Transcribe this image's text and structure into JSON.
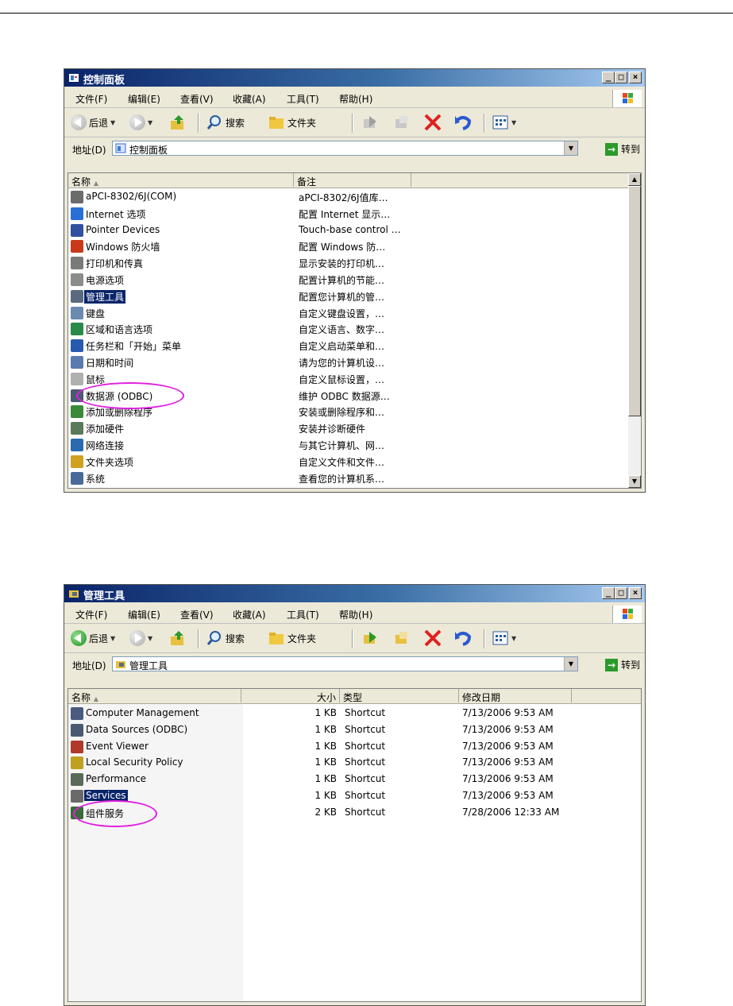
{
  "window1": {
    "title": "控制面板",
    "menu": [
      "文件(F)",
      "编辑(E)",
      "查看(V)",
      "收藏(A)",
      "工具(T)",
      "帮助(H)"
    ],
    "toolbar": {
      "back": "后退",
      "search": "搜索",
      "folders": "文件夹"
    },
    "address_label": "地址(D)",
    "address_value": "控制面板",
    "go_label": "转到",
    "columns": [
      "名称",
      "备注"
    ],
    "rows": [
      {
        "name": "aPCI-8302/6J(COM)",
        "note": "aPCI-8302/6J值库…",
        "icon_color": "#6b6b6b"
      },
      {
        "name": "Internet 选项",
        "note": "配置 Internet 显示…",
        "icon_color": "#2a6fd6"
      },
      {
        "name": "Pointer Devices",
        "note": "Touch-base control …",
        "icon_color": "#3050a0"
      },
      {
        "name": "Windows 防火墙",
        "note": "配置 Windows 防…",
        "icon_color": "#c83a1a"
      },
      {
        "name": "打印机和传真",
        "note": "显示安装的打印机…",
        "icon_color": "#7a7a7a"
      },
      {
        "name": "电源选项",
        "note": "配置计算机的节能…",
        "icon_color": "#8c8c8c"
      },
      {
        "name": "管理工具",
        "note": "配置您计算机的管…",
        "icon_color": "#5a6a80",
        "selected": true
      },
      {
        "name": "键盘",
        "note": "自定义键盘设置，…",
        "icon_color": "#6a8ab0"
      },
      {
        "name": "区域和语言选项",
        "note": "自定义语言、数字…",
        "icon_color": "#2a8a4a"
      },
      {
        "name": "任务栏和「开始」菜单",
        "note": "自定义启动菜单和…",
        "icon_color": "#2a5ab0"
      },
      {
        "name": "日期和时间",
        "note": "请为您的计算机设…",
        "icon_color": "#5a7ab0"
      },
      {
        "name": "鼠标",
        "note": "自定义鼠标设置，…",
        "icon_color": "#b0b0b0"
      },
      {
        "name": "数据源 (ODBC)",
        "note": "维护 ODBC 数据源…",
        "icon_color": "#4a5a70"
      },
      {
        "name": "添加或删除程序",
        "note": "安装或删除程序和…",
        "icon_color": "#3a8a3a"
      },
      {
        "name": "添加硬件",
        "note": "安装并诊断硬件",
        "icon_color": "#5a7a5a"
      },
      {
        "name": "网络连接",
        "note": "与其它计算机、网…",
        "icon_color": "#2a6ab0"
      },
      {
        "name": "文件夹选项",
        "note": "自定义文件和文件…",
        "icon_color": "#d0a020"
      },
      {
        "name": "系统",
        "note": "查看您的计算机系…",
        "icon_color": "#4a6a9a"
      }
    ]
  },
  "window2": {
    "title": "管理工具",
    "menu": [
      "文件(F)",
      "编辑(E)",
      "查看(V)",
      "收藏(A)",
      "工具(T)",
      "帮助(H)"
    ],
    "toolbar": {
      "back": "后退",
      "search": "搜索",
      "folders": "文件夹"
    },
    "address_label": "地址(D)",
    "address_value": "管理工具",
    "go_label": "转到",
    "columns": [
      "名称",
      "大小",
      "类型",
      "修改日期"
    ],
    "rows": [
      {
        "name": "Computer Management",
        "size": "1 KB",
        "type": "Shortcut",
        "date": "7/13/2006 9:53 AM",
        "icon_color": "#4a5a80"
      },
      {
        "name": "Data Sources (ODBC)",
        "size": "1 KB",
        "type": "Shortcut",
        "date": "7/13/2006 9:53 AM",
        "icon_color": "#4a5a70"
      },
      {
        "name": "Event Viewer",
        "size": "1 KB",
        "type": "Shortcut",
        "date": "7/13/2006 9:53 AM",
        "icon_color": "#b03a2a"
      },
      {
        "name": "Local Security Policy",
        "size": "1 KB",
        "type": "Shortcut",
        "date": "7/13/2006 9:53 AM",
        "icon_color": "#c0a020"
      },
      {
        "name": "Performance",
        "size": "1 KB",
        "type": "Shortcut",
        "date": "7/13/2006 9:53 AM",
        "icon_color": "#5a6a5a"
      },
      {
        "name": "Services",
        "size": "1 KB",
        "type": "Shortcut",
        "date": "7/13/2006 9:53 AM",
        "icon_color": "#6a6a6a",
        "selected": true
      },
      {
        "name": "组件服务",
        "size": "2 KB",
        "type": "Shortcut",
        "date": "7/28/2006 12:33 AM",
        "icon_color": "#3a6a3a"
      }
    ]
  },
  "colors": {
    "highlight_ring": "#e020e0",
    "selection": "#0a246a",
    "title_gradient_start": "#0a246a"
  }
}
